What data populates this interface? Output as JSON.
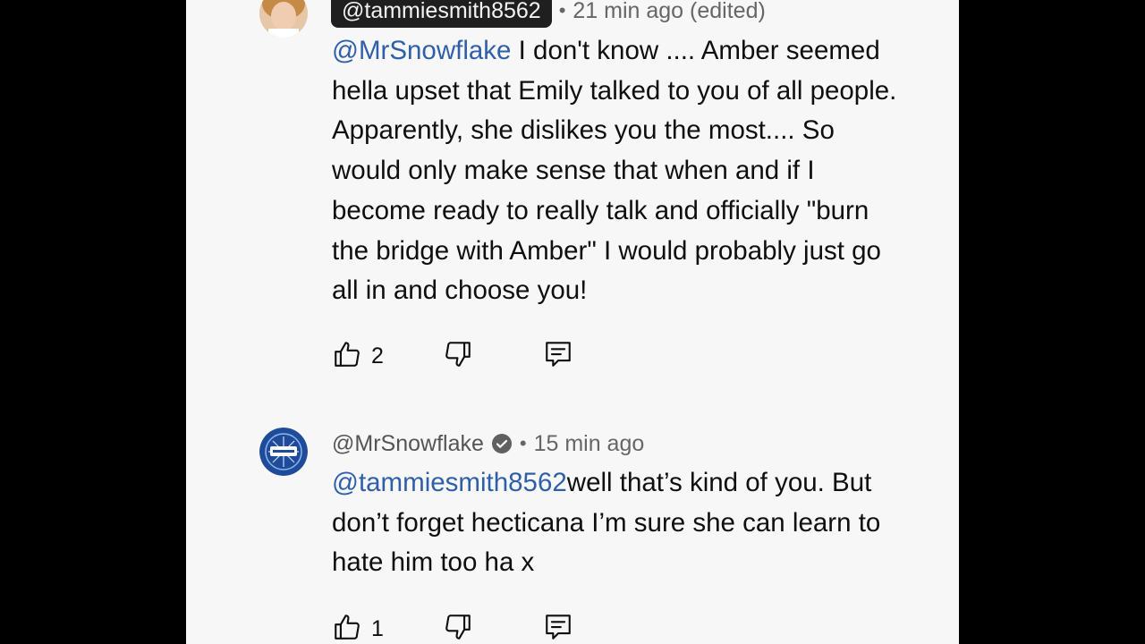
{
  "comments": [
    {
      "handle": "@tammiesmith8562",
      "separator": "•",
      "time": "21 min ago (edited)",
      "mention": "@MrSnowflake",
      "lines": [
        " I don't know .... Amber seemed",
        "hella upset that Emily talked to you of all people.",
        "Apparently, she dislikes you the most.... So",
        "would only make sense that when and if I",
        "become ready to really talk and officially \"burn",
        "the bridge with Amber\" I would probably just go",
        "all in and choose you!"
      ],
      "likes": "2",
      "icons": [
        "like-icon",
        "dislike-icon",
        "reply-icon"
      ]
    },
    {
      "handle": "@MrSnowflake",
      "separator": "•",
      "time": "15 min ago",
      "mention": "@tammiesmith8562",
      "lines": [
        "well that’s kind of you. But",
        "don’t forget hecticana I’m sure she can learn to",
        "hate him too ha x"
      ],
      "likes": "1",
      "icons": [
        "verified-icon",
        "like-icon",
        "dislike-icon",
        "reply-icon"
      ]
    }
  ],
  "colors": {
    "mention": "#2f5fa8",
    "handle_pill": "#1f1f1f",
    "panel": "#f7f7f7",
    "avatar_2": "#1e4b9a"
  }
}
